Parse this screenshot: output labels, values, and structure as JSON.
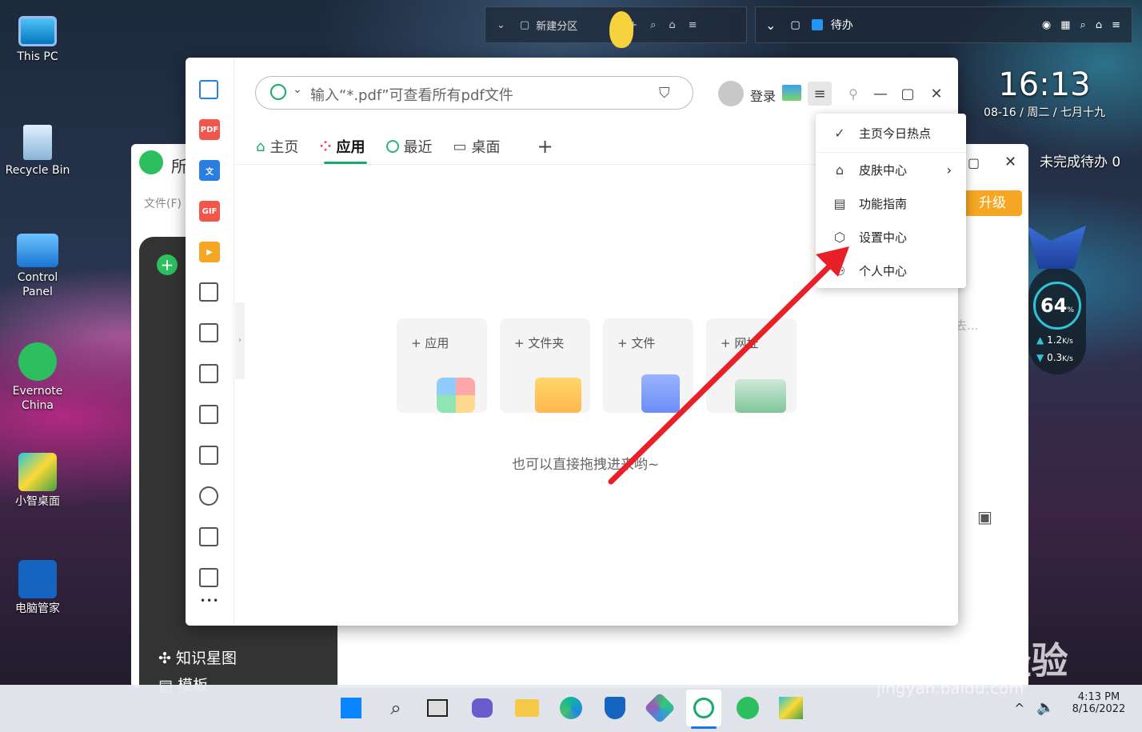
{
  "desktop": {
    "icons": [
      {
        "label": "This PC"
      },
      {
        "label": "Recycle Bin"
      },
      {
        "label": "Control Panel"
      },
      {
        "label": "Evernote China"
      },
      {
        "label": "小智桌面"
      },
      {
        "label": "电脑管家"
      }
    ]
  },
  "fence_left": {
    "title": "新建分区"
  },
  "fence_right": {
    "title": "待办"
  },
  "clock_widget": {
    "time": "16:13",
    "date": "08-16 / 周二 / 七月十九"
  },
  "todo_widget": {
    "text": "未完成待办 0"
  },
  "net_widget": {
    "percent": "64",
    "percent_unit": "%",
    "up": "1.2",
    "down": "0.3",
    "unit": "K/s"
  },
  "evernote_window": {
    "title": "所",
    "menu_file": "文件(F)",
    "upgrade": "升级",
    "sidebar_items": [
      "知识星图",
      "模板"
    ],
    "placeholder_partial": "去..."
  },
  "main_window": {
    "search_placeholder": "输入“*.pdf”可查看所有pdf文件",
    "login": "登录",
    "tabs": [
      {
        "label": "主页"
      },
      {
        "label": "应用",
        "active": true
      },
      {
        "label": "最近"
      },
      {
        "label": "桌面"
      }
    ],
    "add_tab": "+",
    "cards": [
      {
        "label": "+ 应用"
      },
      {
        "label": "+ 文件夹"
      },
      {
        "label": "+ 文件"
      },
      {
        "label": "+ 网址"
      }
    ],
    "drag_hint": "也可以直接拖拽进来哟~",
    "sidebar_icons": [
      "PDF",
      "文",
      "GIF"
    ],
    "more": "•••"
  },
  "dropdown_menu": {
    "items": [
      {
        "label": "主页今日热点",
        "icon": "check-icon"
      },
      {
        "label": "皮肤中心",
        "icon": "shirt-icon",
        "submenu": true
      },
      {
        "label": "功能指南",
        "icon": "doc-icon"
      },
      {
        "label": "设置中心",
        "icon": "gear-icon"
      },
      {
        "label": "个人中心",
        "icon": "user-icon"
      }
    ]
  },
  "taskbar": {
    "time": "4:13 PM",
    "date": "8/16/2022"
  },
  "watermark": {
    "text": "Baidu经验",
    "url": "jingyan.baidu.com"
  },
  "colors": {
    "accent": "#1aab6a",
    "arrow": "#e8202a"
  }
}
